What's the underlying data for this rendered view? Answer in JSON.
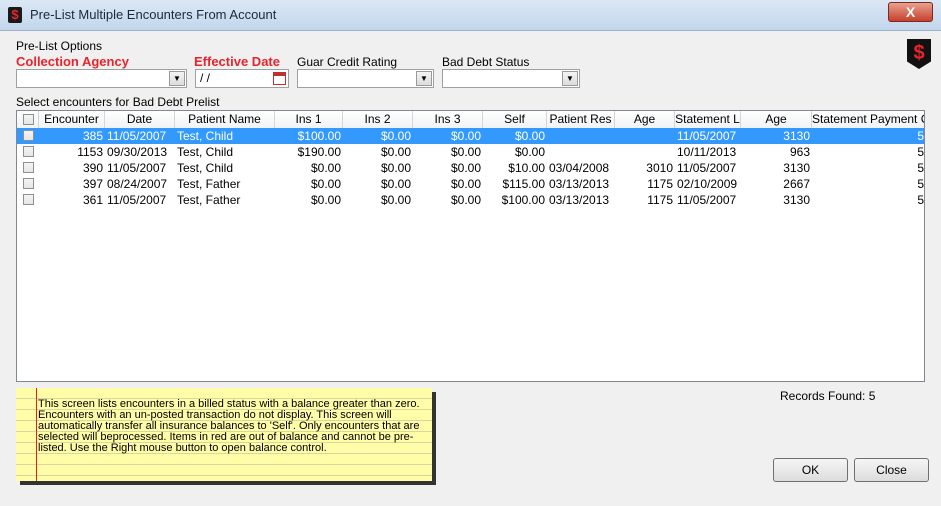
{
  "window": {
    "title": "Pre-List Multiple Encounters From Account",
    "close_glyph": "X",
    "icon_glyph": "$"
  },
  "options": {
    "group_label": "Pre-List Options",
    "collection_agency_label": "Collection Agency",
    "effective_date_label": "Effective Date",
    "effective_date_value": " / /",
    "guar_credit_label": "Guar Credit Rating",
    "bad_debt_label": "Bad Debt Status"
  },
  "grid": {
    "caption": "Select encounters for Bad Debt Prelist",
    "columns": [
      "",
      "Encounter",
      "Date",
      "Patient Name",
      "Ins 1",
      "Ins 2",
      "Ins 3",
      "Self",
      "Patient Res",
      "Age",
      "Statement L",
      "Age",
      "Statement Payment C"
    ],
    "rows": [
      [
        "385",
        "11/05/2007",
        "Test, Child",
        "$100.00",
        "$0.00",
        "$0.00",
        "$0.00",
        "",
        "",
        "11/05/2007",
        "3130",
        "5"
      ],
      [
        "1153",
        "09/30/2013",
        "Test, Child",
        "$190.00",
        "$0.00",
        "$0.00",
        "$0.00",
        "",
        "",
        "10/11/2013",
        "963",
        "5"
      ],
      [
        "390",
        "11/05/2007",
        "Test, Child",
        "$0.00",
        "$0.00",
        "$0.00",
        "$10.00",
        "03/04/2008",
        "3010",
        "11/05/2007",
        "3130",
        "5"
      ],
      [
        "397",
        "08/24/2007",
        "Test, Father",
        "$0.00",
        "$0.00",
        "$0.00",
        "$115.00",
        "03/13/2013",
        "1175",
        "02/10/2009",
        "2667",
        "5"
      ],
      [
        "361",
        "11/05/2007",
        "Test, Father",
        "$0.00",
        "$0.00",
        "$0.00",
        "$100.00",
        "03/13/2013",
        "1175",
        "11/05/2007",
        "3130",
        "5"
      ]
    ]
  },
  "note_text": "This screen lists encounters in a billed status with a balance greater than zero. Encounters with an un-posted transaction do not display.  This screen will automatically transfer all insurance balances to 'Self'.  Only encounters that are selected will beprocessed.  Items in red are out of balance and cannot be pre-listed.  Use the Right mouse button to open balance control.",
  "records_found": "Records Found: 5",
  "buttons": {
    "ok": "OK",
    "close": "Close"
  },
  "icons": {
    "app": "dollar-shield-icon",
    "dropdown": "chevron-down-icon",
    "calendar": "calendar-icon"
  },
  "colors": {
    "accent_red": "#e8242a",
    "selection": "#3399ff"
  }
}
